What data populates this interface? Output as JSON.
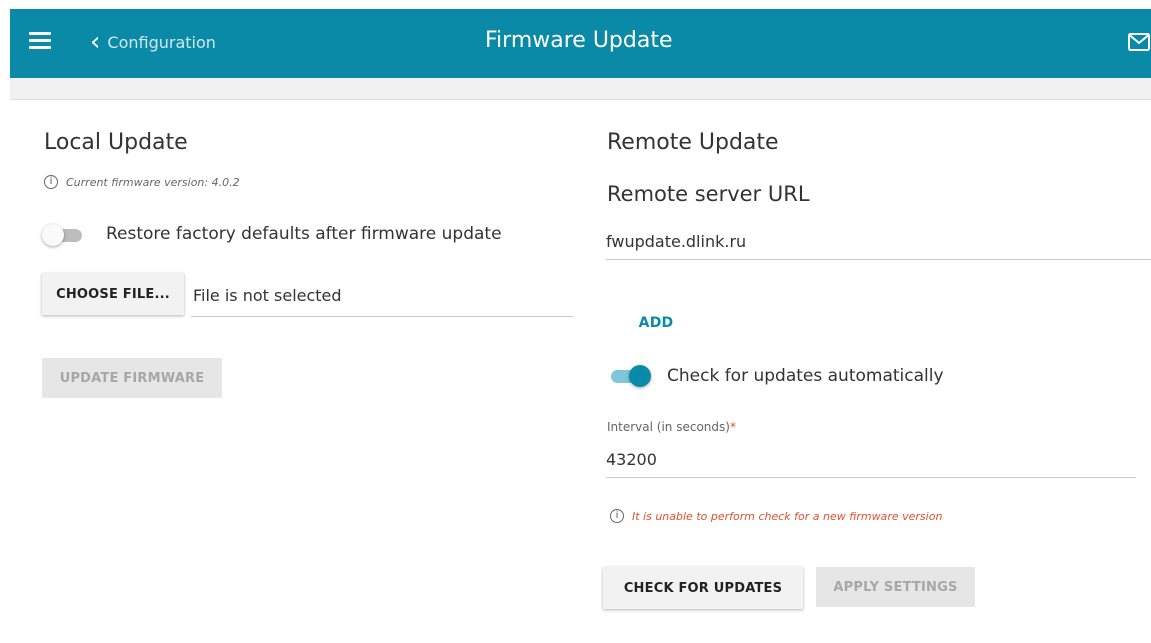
{
  "header": {
    "back_label": "Configuration",
    "title": "Firmware Update",
    "bg_color": "#0b8aa8"
  },
  "local": {
    "title": "Local Update",
    "version_text": "Current firmware version: 4.0.2",
    "restore_label": "Restore factory defaults after firmware update",
    "restore_enabled": false,
    "choose_file_label": "CHOOSE FILE...",
    "file_status": "File is not selected",
    "update_button_label": "UPDATE FIRMWARE"
  },
  "remote": {
    "title": "Remote Update",
    "server_url_heading": "Remote server URL",
    "server_url_value": "fwupdate.dlink.ru",
    "add_label": "ADD",
    "auto_check_label": "Check for updates automatically",
    "auto_check_enabled": true,
    "interval_label": "Interval (in seconds)",
    "interval_required_mark": "*",
    "interval_value": "43200",
    "warning_text": "It is unable to perform check for a new firmware version",
    "check_button_label": "CHECK FOR UPDATES",
    "apply_button_label": "APPLY SETTINGS"
  },
  "icons": {
    "menu": "hamburger-menu-icon",
    "back": "chevron-left-icon",
    "mail": "mail-icon",
    "info": "info-icon"
  },
  "colors": {
    "accent": "#0b8aa8",
    "warning": "#e0522f"
  }
}
